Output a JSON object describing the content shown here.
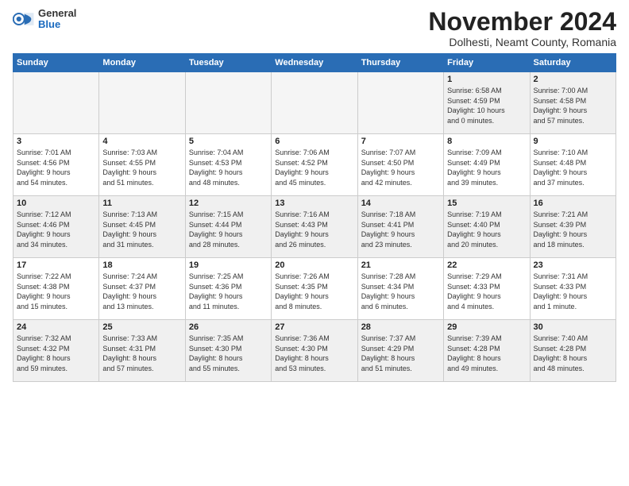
{
  "logo": {
    "general": "General",
    "blue": "Blue"
  },
  "title": "November 2024",
  "subtitle": "Dolhesti, Neamt County, Romania",
  "days_of_week": [
    "Sunday",
    "Monday",
    "Tuesday",
    "Wednesday",
    "Thursday",
    "Friday",
    "Saturday"
  ],
  "weeks": [
    [
      {
        "day": "",
        "info": "",
        "empty": true
      },
      {
        "day": "",
        "info": "",
        "empty": true
      },
      {
        "day": "",
        "info": "",
        "empty": true
      },
      {
        "day": "",
        "info": "",
        "empty": true
      },
      {
        "day": "",
        "info": "",
        "empty": true
      },
      {
        "day": "1",
        "info": "Sunrise: 6:58 AM\nSunset: 4:59 PM\nDaylight: 10 hours\nand 0 minutes."
      },
      {
        "day": "2",
        "info": "Sunrise: 7:00 AM\nSunset: 4:58 PM\nDaylight: 9 hours\nand 57 minutes."
      }
    ],
    [
      {
        "day": "3",
        "info": "Sunrise: 7:01 AM\nSunset: 4:56 PM\nDaylight: 9 hours\nand 54 minutes."
      },
      {
        "day": "4",
        "info": "Sunrise: 7:03 AM\nSunset: 4:55 PM\nDaylight: 9 hours\nand 51 minutes."
      },
      {
        "day": "5",
        "info": "Sunrise: 7:04 AM\nSunset: 4:53 PM\nDaylight: 9 hours\nand 48 minutes."
      },
      {
        "day": "6",
        "info": "Sunrise: 7:06 AM\nSunset: 4:52 PM\nDaylight: 9 hours\nand 45 minutes."
      },
      {
        "day": "7",
        "info": "Sunrise: 7:07 AM\nSunset: 4:50 PM\nDaylight: 9 hours\nand 42 minutes."
      },
      {
        "day": "8",
        "info": "Sunrise: 7:09 AM\nSunset: 4:49 PM\nDaylight: 9 hours\nand 39 minutes."
      },
      {
        "day": "9",
        "info": "Sunrise: 7:10 AM\nSunset: 4:48 PM\nDaylight: 9 hours\nand 37 minutes."
      }
    ],
    [
      {
        "day": "10",
        "info": "Sunrise: 7:12 AM\nSunset: 4:46 PM\nDaylight: 9 hours\nand 34 minutes."
      },
      {
        "day": "11",
        "info": "Sunrise: 7:13 AM\nSunset: 4:45 PM\nDaylight: 9 hours\nand 31 minutes."
      },
      {
        "day": "12",
        "info": "Sunrise: 7:15 AM\nSunset: 4:44 PM\nDaylight: 9 hours\nand 28 minutes."
      },
      {
        "day": "13",
        "info": "Sunrise: 7:16 AM\nSunset: 4:43 PM\nDaylight: 9 hours\nand 26 minutes."
      },
      {
        "day": "14",
        "info": "Sunrise: 7:18 AM\nSunset: 4:41 PM\nDaylight: 9 hours\nand 23 minutes."
      },
      {
        "day": "15",
        "info": "Sunrise: 7:19 AM\nSunset: 4:40 PM\nDaylight: 9 hours\nand 20 minutes."
      },
      {
        "day": "16",
        "info": "Sunrise: 7:21 AM\nSunset: 4:39 PM\nDaylight: 9 hours\nand 18 minutes."
      }
    ],
    [
      {
        "day": "17",
        "info": "Sunrise: 7:22 AM\nSunset: 4:38 PM\nDaylight: 9 hours\nand 15 minutes."
      },
      {
        "day": "18",
        "info": "Sunrise: 7:24 AM\nSunset: 4:37 PM\nDaylight: 9 hours\nand 13 minutes."
      },
      {
        "day": "19",
        "info": "Sunrise: 7:25 AM\nSunset: 4:36 PM\nDaylight: 9 hours\nand 11 minutes."
      },
      {
        "day": "20",
        "info": "Sunrise: 7:26 AM\nSunset: 4:35 PM\nDaylight: 9 hours\nand 8 minutes."
      },
      {
        "day": "21",
        "info": "Sunrise: 7:28 AM\nSunset: 4:34 PM\nDaylight: 9 hours\nand 6 minutes."
      },
      {
        "day": "22",
        "info": "Sunrise: 7:29 AM\nSunset: 4:33 PM\nDaylight: 9 hours\nand 4 minutes."
      },
      {
        "day": "23",
        "info": "Sunrise: 7:31 AM\nSunset: 4:33 PM\nDaylight: 9 hours\nand 1 minute."
      }
    ],
    [
      {
        "day": "24",
        "info": "Sunrise: 7:32 AM\nSunset: 4:32 PM\nDaylight: 8 hours\nand 59 minutes."
      },
      {
        "day": "25",
        "info": "Sunrise: 7:33 AM\nSunset: 4:31 PM\nDaylight: 8 hours\nand 57 minutes."
      },
      {
        "day": "26",
        "info": "Sunrise: 7:35 AM\nSunset: 4:30 PM\nDaylight: 8 hours\nand 55 minutes."
      },
      {
        "day": "27",
        "info": "Sunrise: 7:36 AM\nSunset: 4:30 PM\nDaylight: 8 hours\nand 53 minutes."
      },
      {
        "day": "28",
        "info": "Sunrise: 7:37 AM\nSunset: 4:29 PM\nDaylight: 8 hours\nand 51 minutes."
      },
      {
        "day": "29",
        "info": "Sunrise: 7:39 AM\nSunset: 4:28 PM\nDaylight: 8 hours\nand 49 minutes."
      },
      {
        "day": "30",
        "info": "Sunrise: 7:40 AM\nSunset: 4:28 PM\nDaylight: 8 hours\nand 48 minutes."
      }
    ]
  ]
}
